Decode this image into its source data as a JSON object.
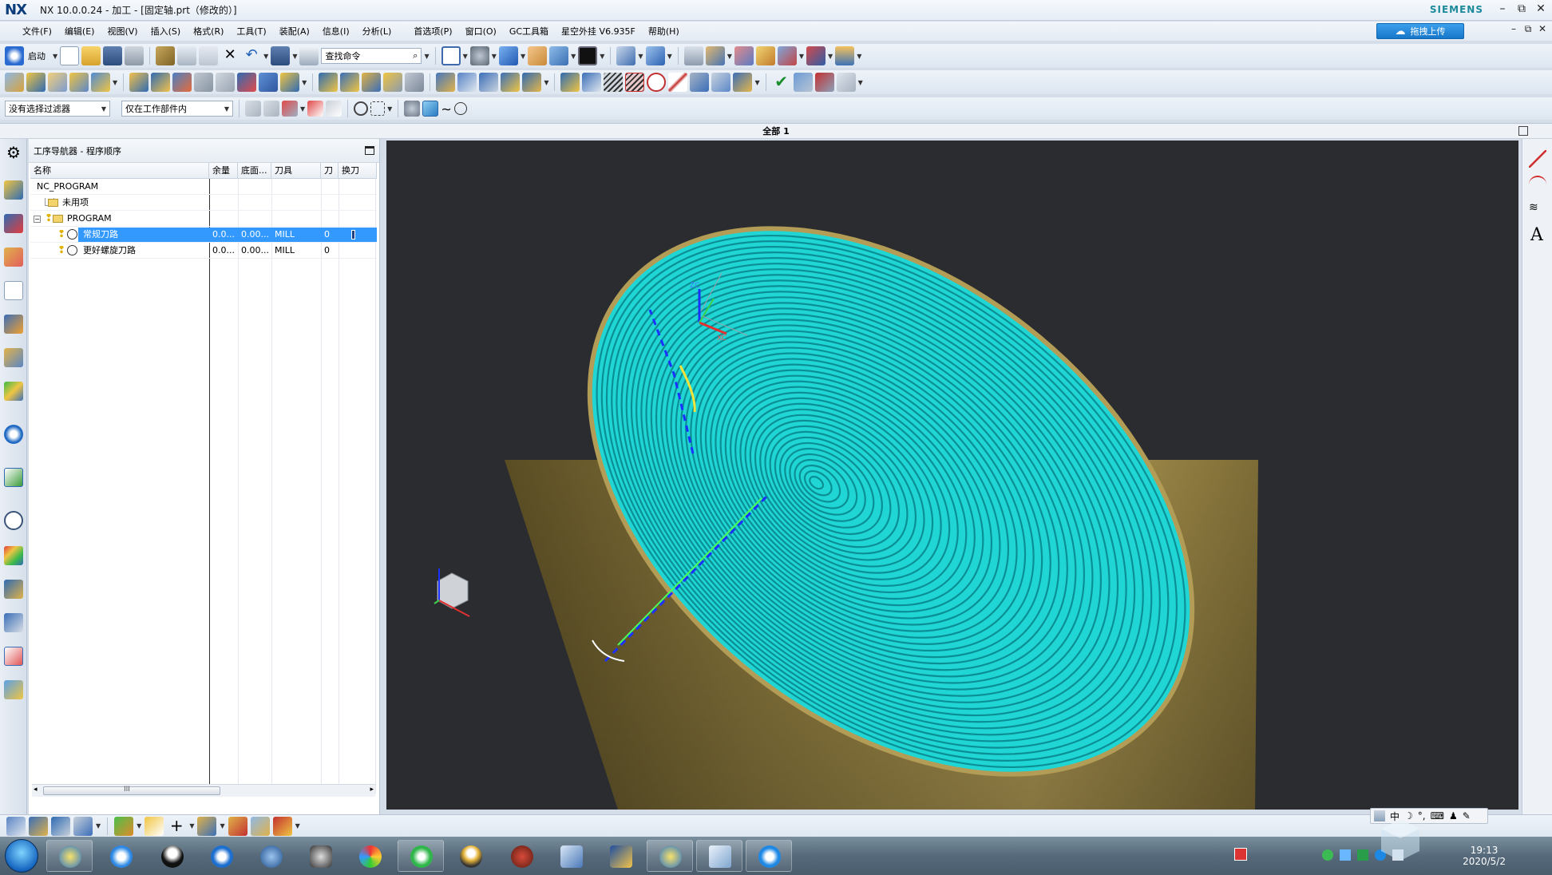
{
  "window": {
    "logo": "NX",
    "title": "NX 10.0.0.24 - 加工 - [固定轴.prt（修改的）]",
    "brand": "SIEMENS",
    "minimize": "–",
    "restore": "⧉",
    "close": "✕"
  },
  "menubar": {
    "items": [
      "文件(F)",
      "编辑(E)",
      "视图(V)",
      "插入(S)",
      "格式(R)",
      "工具(T)",
      "装配(A)",
      "信息(I)",
      "分析(L)",
      "首选项(P)",
      "窗口(O)",
      "GC工具箱",
      "星空外挂 V6.935F",
      "帮助(H)"
    ],
    "upload_button": "拖拽上传"
  },
  "toolbar1": {
    "start_label": "启动",
    "find_placeholder": "查找命令"
  },
  "toolbar3": {
    "filter_selected": "没有选择过滤器",
    "scope_selected": "仅在工作部件内"
  },
  "view_title": "全部 1",
  "navigator": {
    "title": "工序导航器 - 程序顺序",
    "columns": [
      "名称",
      "余量",
      "底面...",
      "刀具",
      "刀",
      "换刀"
    ],
    "rows": [
      {
        "name": "NC_PROGRAM",
        "stock": "",
        "floor": "",
        "tool": "",
        "num": "",
        "change": ""
      },
      {
        "name": "未用项",
        "stock": "",
        "floor": "",
        "tool": "",
        "num": "",
        "change": ""
      },
      {
        "name": "PROGRAM",
        "stock": "",
        "floor": "",
        "tool": "",
        "num": "",
        "change": ""
      },
      {
        "name": "常规刀路",
        "stock": "0.0...",
        "floor": "0.00...",
        "tool": "MILL",
        "num": "0",
        "change": ""
      },
      {
        "name": "更好螺旋刀路",
        "stock": "0.0...",
        "floor": "0.00...",
        "tool": "MILL",
        "num": "0",
        "change": ""
      }
    ],
    "scroll_label": "III"
  },
  "ime": {
    "mode": "中"
  },
  "tray": {
    "time": "19:13",
    "date": "2020/5/2"
  },
  "colors": {
    "accent": "#3399ff",
    "viewport_bg": "#2b2c30",
    "face_cyan": "#27e3e0",
    "cylinder": "#a38f4c"
  }
}
